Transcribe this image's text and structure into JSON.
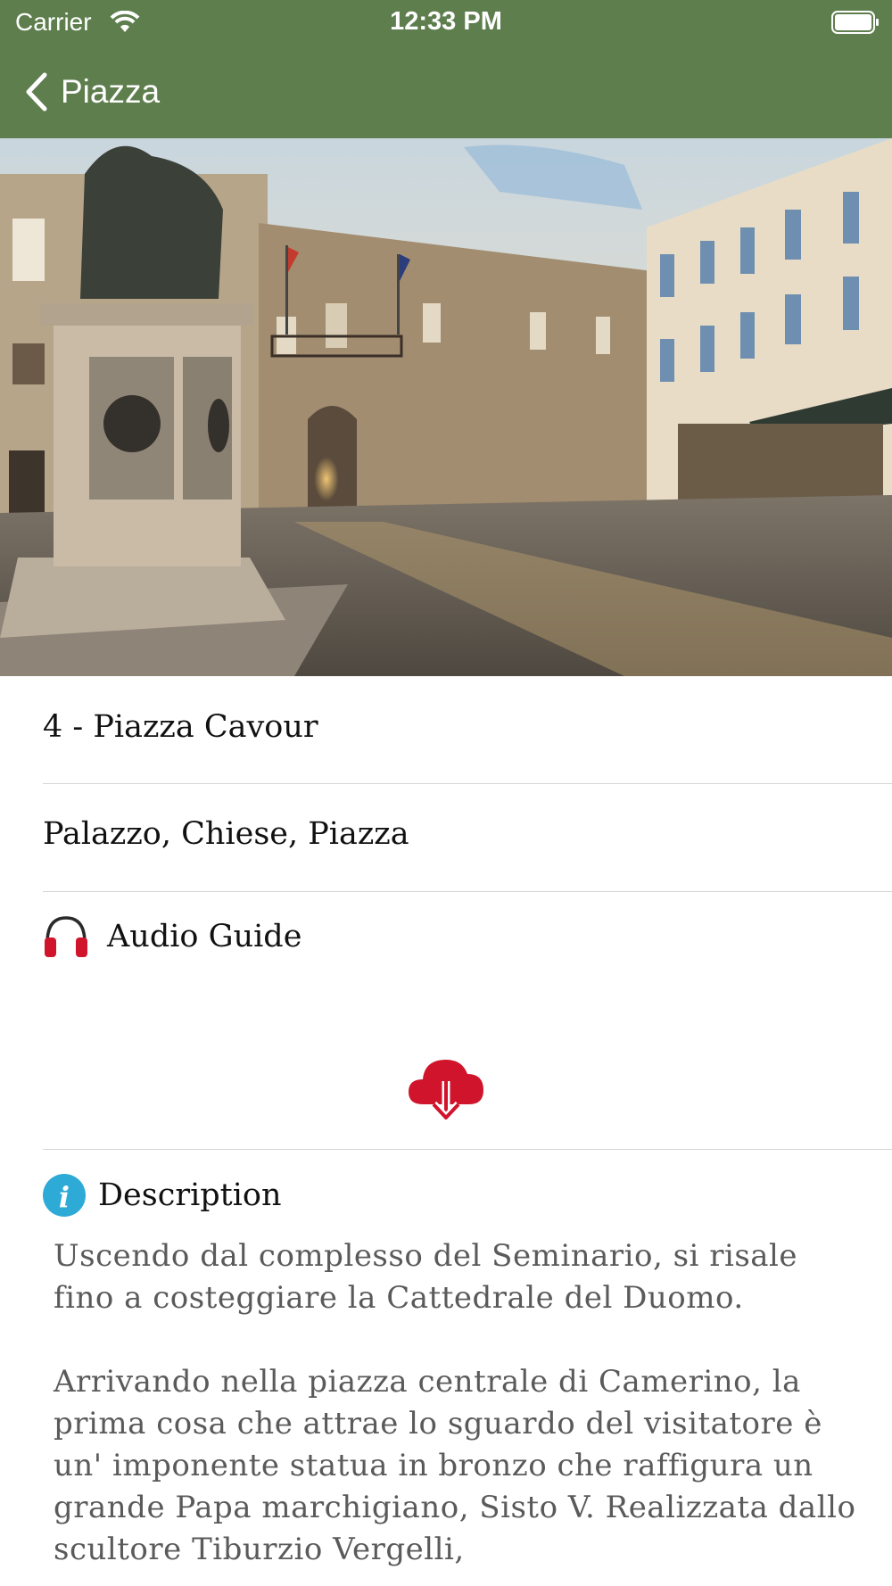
{
  "status_bar": {
    "carrier": "Carrier",
    "time": "12:33 PM"
  },
  "nav": {
    "back_label": "Piazza",
    "bar_color": "#5e7e4e"
  },
  "hero_image": {
    "subject": "town-square-with-statue-photo"
  },
  "details": {
    "title": "4 - Piazza Cavour",
    "categories": "Palazzo, Chiese, Piazza",
    "audio_label": "Audio Guide",
    "accent_color": "#d0142c"
  },
  "description": {
    "heading": "Description",
    "icon_color": "#2eaad6",
    "text": "Uscendo dal complesso del Seminario, si risale fino a costeggiare la Cattedrale del Duomo.\n\nArrivando nella piazza centrale di Camerino, la prima cosa che attrae lo sguardo del visitatore è un' imponente statua in bronzo che raffigura un grande Papa marchigiano, Sisto V. Realizzata dallo scultore Tiburzio Vergelli,"
  }
}
